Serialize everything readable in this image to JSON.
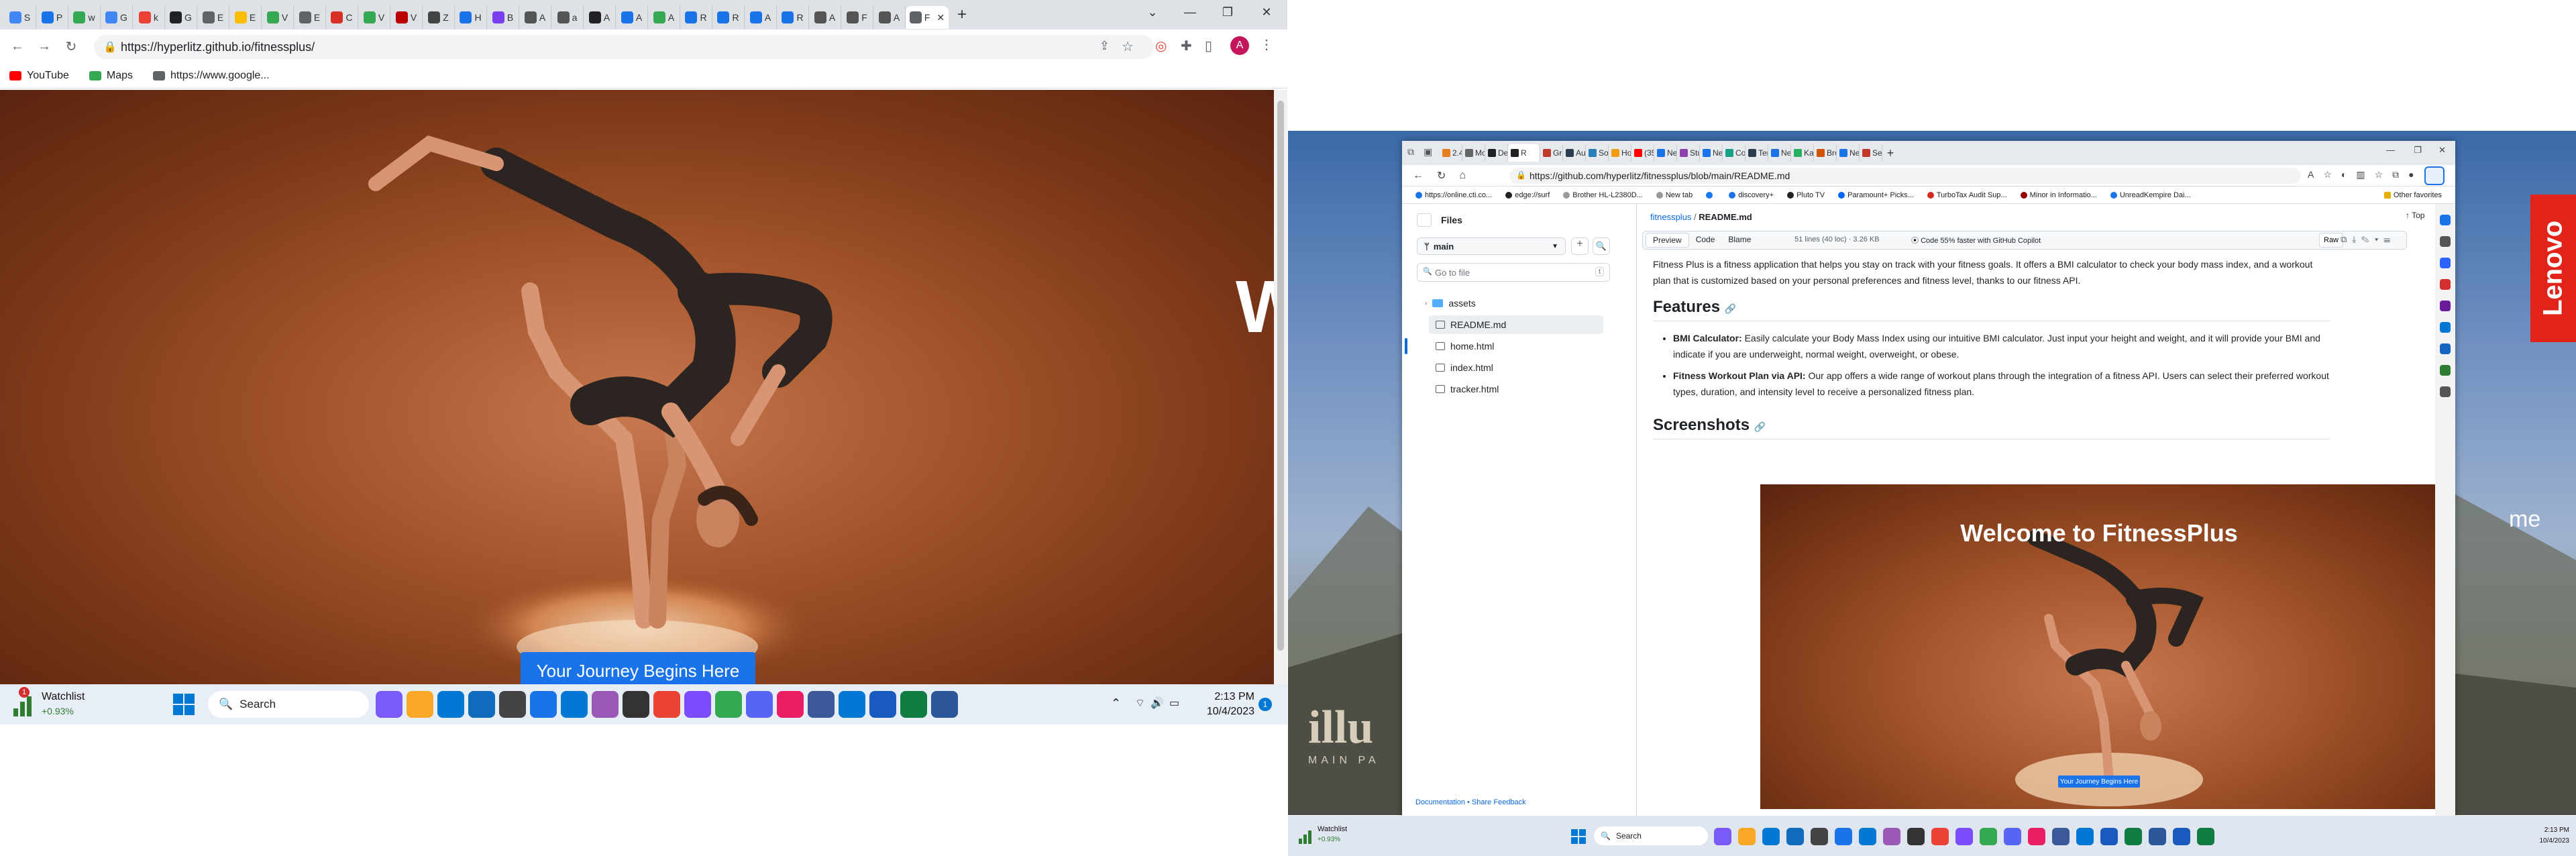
{
  "left_browser": {
    "tabs": [
      {
        "label": "S",
        "color": "#4285f4"
      },
      {
        "label": "P",
        "color": "#1a73e8"
      },
      {
        "label": "w",
        "color": "#34a853"
      },
      {
        "label": "G",
        "color": "#4285f4"
      },
      {
        "label": "k",
        "color": "#ea4335"
      },
      {
        "label": "G",
        "color": "#202124"
      },
      {
        "label": "E",
        "color": "#5f6368"
      },
      {
        "label": "E",
        "color": "#fbbc04"
      },
      {
        "label": "V",
        "color": "#34a853"
      },
      {
        "label": "E",
        "color": "#5f6368"
      },
      {
        "label": "C",
        "color": "#d93025"
      },
      {
        "label": "V",
        "color": "#34a853"
      },
      {
        "label": "V",
        "color": "#b00"
      },
      {
        "label": "Z",
        "color": "#444"
      },
      {
        "label": "H",
        "color": "#1a73e8"
      },
      {
        "label": "B",
        "color": "#7b3ff2"
      },
      {
        "label": "A",
        "color": "#555"
      },
      {
        "label": "a",
        "color": "#555"
      },
      {
        "label": "A",
        "color": "#202124"
      },
      {
        "label": "A",
        "color": "#1a73e8"
      },
      {
        "label": "A",
        "color": "#34a853"
      },
      {
        "label": "R",
        "color": "#1a73e8"
      },
      {
        "label": "R",
        "color": "#1a73e8"
      },
      {
        "label": "A",
        "color": "#1a73e8"
      },
      {
        "label": "R",
        "color": "#1a73e8"
      },
      {
        "label": "A",
        "color": "#555"
      },
      {
        "label": "F",
        "color": "#555"
      },
      {
        "label": "A",
        "color": "#555"
      }
    ],
    "active_tab_label": "F",
    "url": "https://hyperlitz.github.io/fitnessplus/",
    "bookmarks": [
      {
        "label": "YouTube",
        "icon": "youtube-icon",
        "color": "#ff0000"
      },
      {
        "label": "Maps",
        "icon": "maps-icon",
        "color": "#34a853"
      },
      {
        "label": "https://www.google...",
        "icon": "globe-icon",
        "color": "#5f6368"
      }
    ],
    "hero_partial_text": "W",
    "hero_button": "Your Journey Begins Here",
    "profile_initial": "A"
  },
  "left_taskbar": {
    "watchlist_title": "Watchlist",
    "watchlist_change": "+0.93%",
    "watchlist_badge": "1",
    "search_placeholder": "Search",
    "time": "2:13 PM",
    "date": "10/4/2023",
    "notification_count": "1"
  },
  "right_browser": {
    "url": "https://github.com/hyperlitz/fitnessplus/blob/main/README.md",
    "tabs": [
      "2.4.6",
      "Moc",
      "Depl",
      "R",
      "Gradi",
      "Audi",
      "Sour",
      "How",
      "(356)",
      "New",
      "Stud",
      "New",
      "Con",
      "Tem",
      "New",
      "Karn",
      "Brow",
      "New",
      "Sen"
    ],
    "favorites": [
      {
        "label": "https://online.cti.co...",
        "color": "#1a73e8"
      },
      {
        "label": "edge://surf",
        "color": "#222"
      },
      {
        "label": "Brother HL-L2380D...",
        "color": "#999"
      },
      {
        "label": "New tab",
        "color": "#999"
      },
      {
        "label": "",
        "color": "#1877f2"
      },
      {
        "label": "discovery+",
        "color": "#1a73e8"
      },
      {
        "label": "Pluto TV",
        "color": "#222"
      },
      {
        "label": "Paramount+ Picks...",
        "color": "#0064ff"
      },
      {
        "label": "TurboTax Audit Sup...",
        "color": "#d52b1e"
      },
      {
        "label": "Minor in Informatio...",
        "color": "#990000"
      },
      {
        "label": "UnreadKempire Dai...",
        "color": "#1a73e8"
      }
    ],
    "other_favorites": "Other favorites"
  },
  "github": {
    "sidebar_title": "Files",
    "branch": "main",
    "goto_placeholder": "Go to file",
    "goto_shortcut": "t",
    "files": [
      {
        "name": "assets",
        "type": "folder"
      },
      {
        "name": "README.md",
        "type": "file"
      },
      {
        "name": "home.html",
        "type": "file"
      },
      {
        "name": "index.html",
        "type": "file"
      },
      {
        "name": "tracker.html",
        "type": "file"
      }
    ],
    "footer_links": "Documentation • Share Feedback",
    "breadcrumb_repo": "fitnessplus",
    "breadcrumb_sep": "/",
    "breadcrumb_file": "README.md",
    "top_link": "Top",
    "view_tabs": [
      "Preview",
      "Code",
      "Blame"
    ],
    "file_meta": "51 lines (40 loc) · 3.26 KB",
    "copilot_note": "Code 55% faster with GitHub Copilot",
    "raw_label": "Raw",
    "intro": "Fitness Plus is a fitness application that helps you stay on track with your fitness goals. It offers a BMI calculator to check your body mass index, and a workout plan that is customized based on your personal preferences and fitness level, thanks to our fitness API.",
    "features_heading": "Features",
    "features": [
      {
        "title": "BMI Calculator:",
        "text": " Easily calculate your Body Mass Index using our intuitive BMI calculator. Just input your height and weight, and it will provide your BMI and indicate if you are underweight, normal weight, overweight, or obese."
      },
      {
        "title": "Fitness Workout Plan via API:",
        "text": " Our app offers a wide range of workout plans through the integration of a fitness API. Users can select their preferred workout types, duration, and intensity level to receive a personalized fitness plan."
      }
    ],
    "screenshots_heading": "Screenshots",
    "screenshot_title": "Welcome to FitnessPlus",
    "screenshot_button": "Your Journey Begins Here"
  },
  "right_desktop": {
    "lenovo": "Lenovo",
    "movie_text": "illu",
    "movie_sub": "MAIN PA",
    "edge_partial": "me"
  },
  "right_taskbar": {
    "watchlist_title": "Watchlist",
    "watchlist_change": "+0.93%",
    "search_placeholder": "Search",
    "time": "2:13 PM",
    "date": "10/4/2023"
  }
}
